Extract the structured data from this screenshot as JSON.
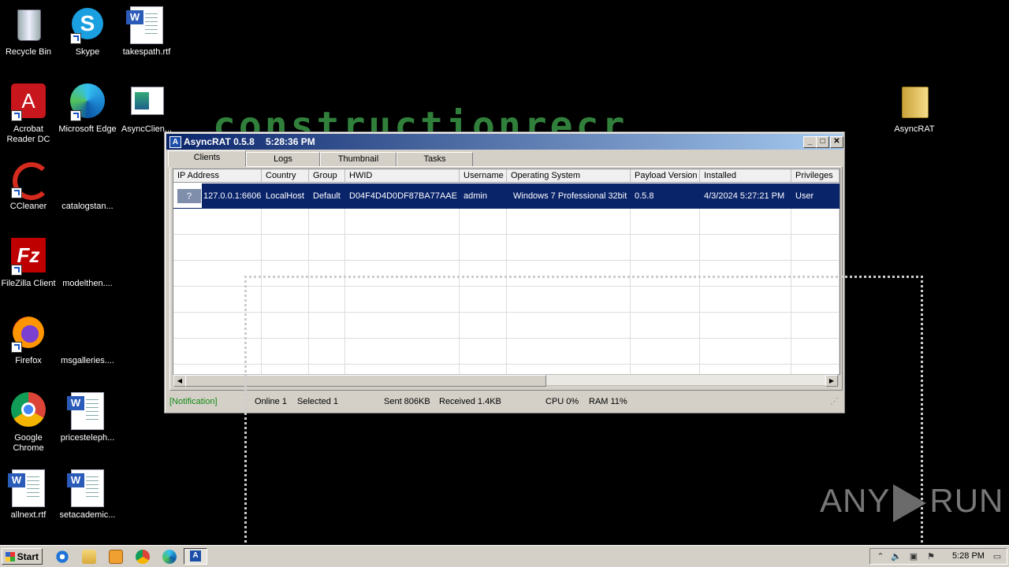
{
  "desktop": {
    "icons": [
      {
        "label": "Recycle Bin"
      },
      {
        "label": "Skype"
      },
      {
        "label": "takespath.rtf"
      },
      {
        "label": "Acrobat Reader DC"
      },
      {
        "label": "Microsoft Edge"
      },
      {
        "label": "AsyncClien..."
      },
      {
        "label": "CCleaner"
      },
      {
        "label": "catalogstan..."
      },
      {
        "label": "FileZilla Client"
      },
      {
        "label": "modelthen...."
      },
      {
        "label": "Firefox"
      },
      {
        "label": "msgalleries...."
      },
      {
        "label": "Google Chrome"
      },
      {
        "label": "pricesteleph..."
      },
      {
        "label": "allnext.rtf"
      },
      {
        "label": "setacademic..."
      },
      {
        "label": "AsyncRAT"
      }
    ],
    "banner_text": "constructionrecr",
    "watermark": {
      "left": "ANY",
      "right": "RUN"
    }
  },
  "window": {
    "title": "AsyncRAT 0.5.8",
    "time": "5:28:36 PM",
    "app_icon_glyph": "A",
    "controls": {
      "minimize": "_",
      "maximize": "□",
      "close": "✕"
    },
    "tabs": [
      {
        "label": "Clients",
        "active": true
      },
      {
        "label": "Logs",
        "active": false
      },
      {
        "label": "Thumbnail",
        "active": false
      },
      {
        "label": "Tasks",
        "active": false
      }
    ],
    "columns": [
      "IP Address",
      "Country",
      "Group",
      "HWID",
      "Username",
      "Operating System",
      "Payload Version",
      "Installed",
      "Privileges"
    ],
    "rows": [
      {
        "thumb": "?",
        "ip": "127.0.0.1:6606",
        "country": "LocalHost",
        "group": "Default",
        "hwid": "D04F4D4D0DF87BA77AAE",
        "username": "admin",
        "os": "Windows 7 Professional  32bit",
        "payload_version": "0.5.8",
        "installed": "4/3/2024 5:27:21 PM",
        "privileges": "User",
        "selected": true
      }
    ],
    "status": {
      "notification": "[Notification]",
      "online": "Online 1",
      "selected": "Selected 1",
      "sent": "Sent 806KB",
      "received": "Received 1.4KB",
      "cpu": "CPU 0%",
      "ram": "RAM 11%"
    }
  },
  "taskbar": {
    "start_label": "Start",
    "clock": "5:28 PM"
  },
  "colors": {
    "selection": "#0a246a",
    "notification": "#138a13",
    "banner": "#3da04a"
  }
}
